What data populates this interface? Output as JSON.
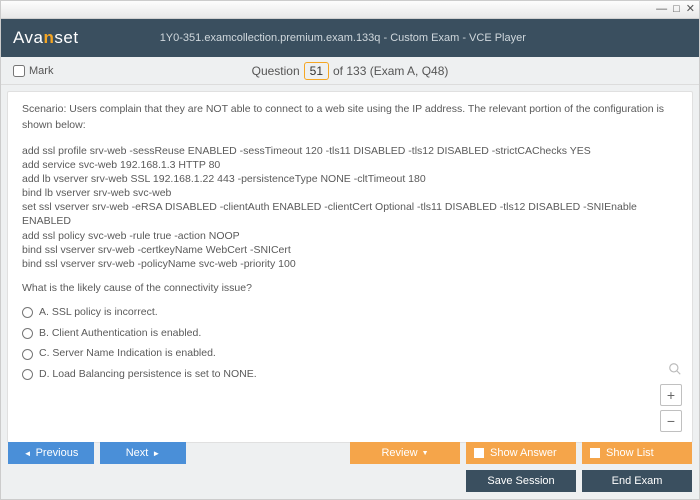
{
  "window": {
    "title": "1Y0-351.examcollection.premium.exam.133q - Custom Exam - VCE Player"
  },
  "logo": {
    "pre": "Ava",
    "accent": "n",
    "post": "set"
  },
  "qbar": {
    "mark_label": "Mark",
    "question_word": "Question",
    "current": "51",
    "total_suffix": " of 133 (Exam A, Q48)"
  },
  "content": {
    "scenario": "Scenario: Users complain that they are NOT able to connect to a web site using the IP address. The relevant portion of the configuration is shown below:",
    "config": "add ssl profile srv-web -sessReuse ENABLED -sessTimeout 120 -tls11 DISABLED -tls12 DISABLED -strictCAChecks YES\nadd service svc-web 192.168.1.3 HTTP 80\nadd lb vserver srv-web SSL 192.168.1.22 443 -persistenceType NONE -cltTimeout 180\nbind lb vserver srv-web svc-web\nset ssl vserver srv-web -eRSA DISABLED -clientAuth ENABLED -clientCert Optional -tls11 DISABLED -tls12 DISABLED -SNIEnable ENABLED\nadd ssl policy svc-web -rule true -action NOOP\nbind ssl vserver srv-web -certkeyName WebCert -SNICert\nbind ssl vserver srv-web -policyName svc-web -priority 100",
    "question": "What is the likely cause of the connectivity issue?",
    "options": [
      "A.  SSL policy is incorrect.",
      "B.  Client Authentication is enabled.",
      "C.  Server Name Indication is enabled.",
      "D.  Load Balancing persistence is set to NONE."
    ]
  },
  "footer": {
    "previous": "Previous",
    "next": "Next",
    "review": "Review",
    "show_answer": "Show Answer",
    "show_list": "Show List",
    "save_session": "Save Session",
    "end_exam": "End Exam"
  },
  "zoom": {
    "plus": "+",
    "minus": "−"
  }
}
